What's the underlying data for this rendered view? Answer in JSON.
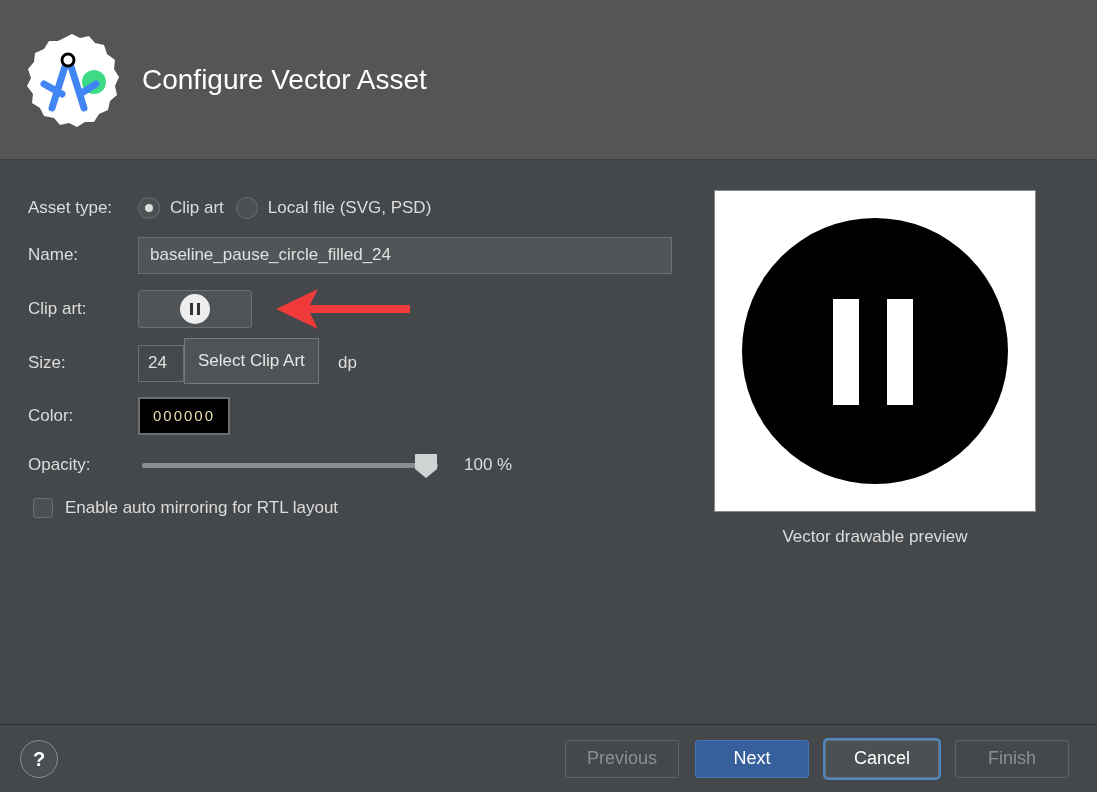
{
  "header": {
    "title": "Configure Vector Asset"
  },
  "asset_type": {
    "label": "Asset type:",
    "options": [
      {
        "label": "Clip art",
        "selected": true
      },
      {
        "label": "Local file (SVG, PSD)",
        "selected": false
      }
    ]
  },
  "name": {
    "label": "Name:",
    "value": "baseline_pause_circle_filled_24"
  },
  "clip_art": {
    "label": "Clip art:",
    "tooltip": "Select Clip Art"
  },
  "size": {
    "label": "Size:",
    "value": "24",
    "unit": "dp"
  },
  "color": {
    "label": "Color:",
    "value": "000000"
  },
  "opacity": {
    "label": "Opacity:",
    "level": 1,
    "reading": "100 %"
  },
  "auto_mirroring": {
    "label": "Enable auto mirroring for RTL layout",
    "checked": false
  },
  "preview": {
    "caption": "Vector drawable preview"
  },
  "footer": {
    "help": "?",
    "buttons": [
      {
        "label": "Previous",
        "kind": "normal",
        "disabled": true,
        "focused": false
      },
      {
        "label": "Next",
        "kind": "primary",
        "disabled": false,
        "focused": false
      },
      {
        "label": "Cancel",
        "kind": "normal",
        "disabled": false,
        "focused": true
      },
      {
        "label": "Finish",
        "kind": "normal",
        "disabled": true,
        "focused": false
      }
    ]
  }
}
